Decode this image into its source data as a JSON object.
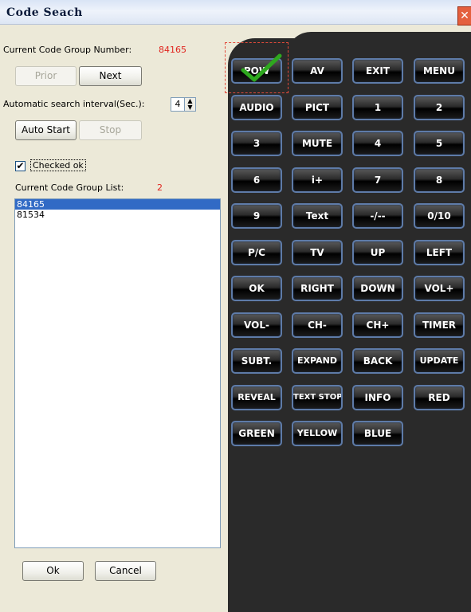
{
  "window": {
    "title": "Code Seach",
    "close_icon": "close-icon"
  },
  "left": {
    "group_label": "Current Code  Group Number:",
    "group_number": "84165",
    "prior_label": "Prior",
    "next_label": "Next",
    "interval_label": "Automatic search interval(Sec.):",
    "interval_value": "4",
    "auto_start_label": "Auto Start",
    "stop_label": "Stop",
    "checked_label": "Checked ok",
    "checked": true,
    "list_label": "Current Code Group List:",
    "list_count": "2",
    "list_items": [
      "84165",
      "81534"
    ],
    "selected_index": 0,
    "ok_label": "Ok",
    "cancel_label": "Cancel"
  },
  "remote": {
    "buttons": [
      "POW",
      "AV",
      "EXIT",
      "MENU",
      "AUDIO",
      "PICT",
      "1",
      "2",
      "3",
      "MUTE",
      "4",
      "5",
      "6",
      "i+",
      "7",
      "8",
      "9",
      "Text",
      "-/--",
      "0/10",
      "P/C",
      "TV",
      "UP",
      "LEFT",
      "OK",
      "RIGHT",
      "DOWN",
      "VOL+",
      "VOL-",
      "CH-",
      "CH+",
      "TIMER",
      "SUBT.",
      "EXPAND",
      "BACK",
      "UPDATE",
      "REVEAL",
      "TEXT STOP",
      "INFO",
      "RED",
      "GREEN",
      "YELLOW",
      "BLUE"
    ],
    "checked_button": "POW",
    "accent": "#e24a3a",
    "check_color": "#2ea81e"
  }
}
